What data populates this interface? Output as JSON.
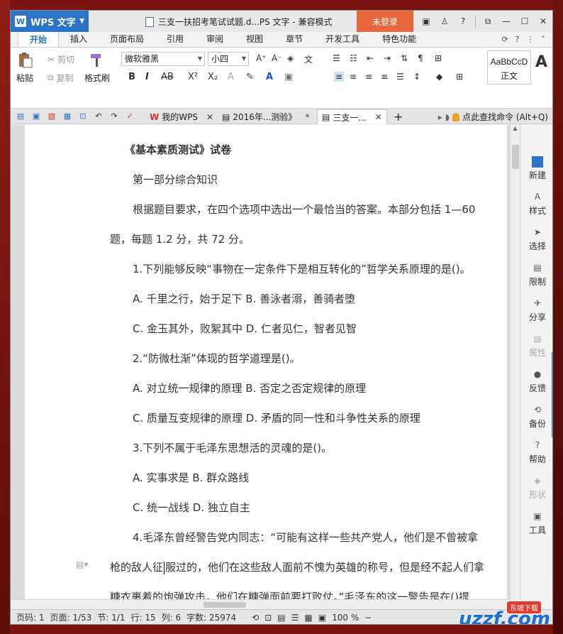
{
  "app": {
    "name": "WPS 文字",
    "doc_title": "三支一扶招考笔试试题.d...PS 文字 - 兼容模式",
    "login": "未登录"
  },
  "menu": {
    "tabs": [
      "开始",
      "插入",
      "页面布局",
      "引用",
      "审阅",
      "视图",
      "章节",
      "开发工具",
      "特色功能"
    ]
  },
  "ribbon": {
    "paste": "粘贴",
    "cut": "剪切",
    "copy": "复制",
    "format_painter": "格式刷",
    "font_name": "微软雅黑",
    "font_size": "小四",
    "style_sample": "AaBbCcD",
    "style_name": "正文",
    "bold": "B",
    "italic": "I",
    "strike": "AB",
    "superscript": "X²",
    "subscript": "X₂"
  },
  "tabs": [
    {
      "label": "我的WPS"
    },
    {
      "label": "2016年...测验》"
    },
    {
      "label": "三支一..."
    }
  ],
  "search_command": "点此查找命令 (Alt+Q)",
  "document": {
    "title": "《基本素质测试》试卷",
    "lines": [
      "第一部分综合知识",
      "根据题目要求，在四个选项中选出一个最恰当的答案。本部分包括 1—60",
      "题，每题 1.2 分，共 72 分。",
      "1.下列能够反映“事物在一定条件下是相互转化的”哲学关系原理的是()。",
      "A. 千里之行，始于足下 B. 善泳者溺，善骑者堕",
      "C. 金玉其外，败絮其中 D. 仁者见仁，智者见智",
      "2.“防微杜渐”体现的哲学道理是()。",
      "A. 对立统一规律的原理 B. 否定之否定规律的原理",
      "C. 质量互变规律的原理 D. 矛盾的同一性和斗争性关系的原理",
      "3.下列不属于毛泽东思想活的灵魂的是()。",
      "A. 实事求是 B. 群众路线",
      "C. 统一战线 D. 独立自主",
      "4.毛泽东曾经警告党内同志：“可能有这样一些共产党人，他们是不曾被拿",
      "枪的敌人征服过的，他们在这些敌人面前不愧为英雄的称号，但是经不起人们拿",
      "糖衣裹着的炮弹攻击，他们在糖弹面前要打败仗。”毛泽东的这一警告是在()提"
    ],
    "cursor_line_before": "枪的敌人征",
    "cursor_line_after": "服过的，他们在这些敌人面前不愧为英雄的称号，但是经不起人们拿"
  },
  "sidebar": {
    "items": [
      {
        "label": "新建"
      },
      {
        "label": "样式"
      },
      {
        "label": "选择"
      },
      {
        "label": "限制"
      },
      {
        "label": "分享"
      },
      {
        "label": "属性"
      },
      {
        "label": "反馈"
      },
      {
        "label": "备份"
      },
      {
        "label": "帮助"
      },
      {
        "label": "形状"
      },
      {
        "label": "工具"
      }
    ]
  },
  "status": {
    "page_num": "页码: 1",
    "pages": "页面: 1/53",
    "section": "节: 1/1",
    "line": "行: 15",
    "column": "列: 6",
    "words": "字数: 25974",
    "zoom": "100 %"
  },
  "watermark": {
    "brand": "uzzf.com",
    "tag": "东坡下载"
  },
  "colors": {
    "accent": "#2b74c8",
    "login": "#e8663d"
  }
}
